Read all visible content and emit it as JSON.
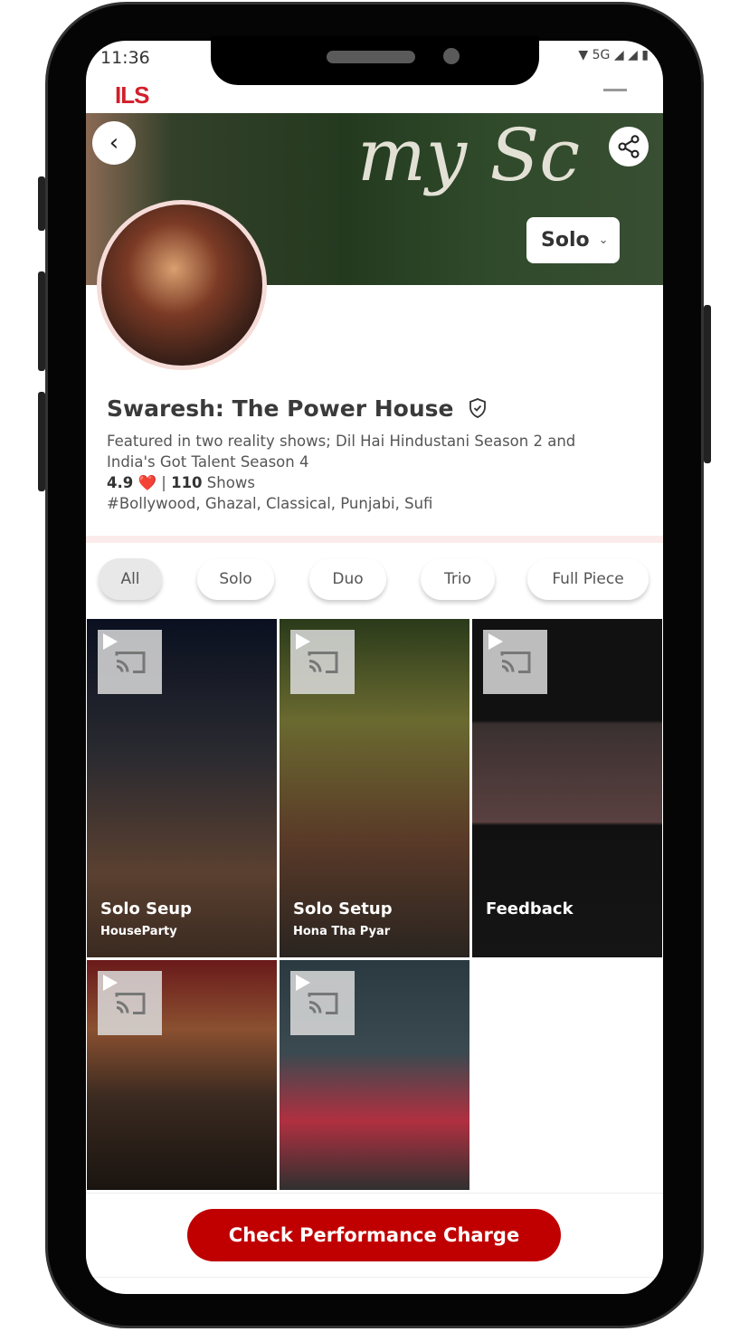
{
  "status_bar": {
    "time": "11:36",
    "network": "5G"
  },
  "app": {
    "logo": "ILS"
  },
  "banner": {
    "neon_text": "my Sc",
    "format_select": "Solo"
  },
  "profile": {
    "name": "Swaresh: The Power House",
    "description_lines": [
      "Featured in two reality shows; Dil Hai Hindustani Season 2 and",
      "India's Got Talent Season 4"
    ],
    "rating": "4.9",
    "heart": "❤️",
    "separator": "|",
    "shows_count": "110",
    "shows_label": "Shows",
    "genres": "#Bollywood, Ghazal, Classical, Punjabi, Sufi"
  },
  "filters": [
    {
      "label": "All",
      "active": true
    },
    {
      "label": "Solo"
    },
    {
      "label": "Duo"
    },
    {
      "label": "Trio"
    },
    {
      "label": "Full Piece"
    }
  ],
  "videos": [
    {
      "title": "Solo Seup",
      "subtitle": "HouseParty"
    },
    {
      "title": "Solo Setup",
      "subtitle": "Hona Tha Pyar"
    },
    {
      "title": "Feedback",
      "subtitle": ""
    },
    {
      "title": "",
      "subtitle": ""
    },
    {
      "title": "",
      "subtitle": ""
    }
  ],
  "cta": {
    "label": "Check Performance Charge"
  },
  "colors": {
    "accent": "#c00000",
    "logo": "#d21f2b"
  }
}
